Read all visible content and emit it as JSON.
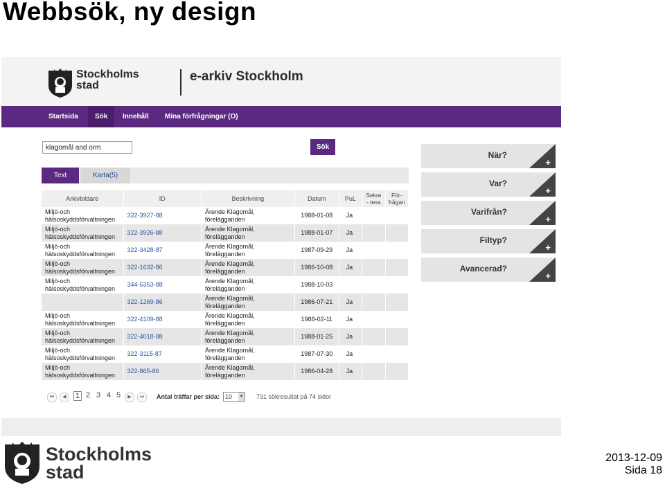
{
  "slide": {
    "title": "Webbsök, ny design",
    "date": "2013-12-09",
    "page": "Sida 18",
    "footer_logo_text": "Stockholms stad"
  },
  "header": {
    "logo_text": "Stockholms stad",
    "site_name": "e-arkiv Stockholm"
  },
  "nav": {
    "items": [
      {
        "label": "Startsida"
      },
      {
        "label": "Sök"
      },
      {
        "label": "Innehåll"
      },
      {
        "label": "Mina förfrågningar (O)"
      }
    ]
  },
  "search": {
    "value": "klagomål and orm",
    "button_label": "Sök"
  },
  "tabs": [
    {
      "label": "Text"
    },
    {
      "label": "Karta(5)"
    }
  ],
  "table": {
    "columns": [
      "Arkivbildare",
      "ID",
      "Beskrivning",
      "Datum",
      "PuL",
      "Sekre - tess",
      "För- frågan"
    ],
    "rows": [
      {
        "arkivbildare": "Miljö-och hälsoskyddsförvaltningen",
        "id": "322-3927-88",
        "beskrivning": "Ärende Klagomål, förelägganden",
        "datum": "1988-01-08",
        "pul": "Ja"
      },
      {
        "arkivbildare": "Miljö-och hälsoskyddsförvaltningen",
        "id": "322-3926-88",
        "beskrivning": "Ärende Klagomål, förelägganden",
        "datum": "1988-01-07",
        "pul": "Ja"
      },
      {
        "arkivbildare": "Miljö-och hälsoskyddsförvaltningen",
        "id": "322-3428-87",
        "beskrivning": "Ärende Klagomål, förelägganden",
        "datum": "1987-09-29",
        "pul": "Ja"
      },
      {
        "arkivbildare": "Miljö-och hälsoskyddsförvaltningen",
        "id": "322-1632-86",
        "beskrivning": "Ärende Klagomål, förelägganden",
        "datum": "1986-10-08",
        "pul": "Ja"
      },
      {
        "arkivbildare": "Miljö-och hälsoskyddsförvaltningen",
        "id": "344-5353-88",
        "beskrivning": "Ärende Klagomål, förelägganden",
        "datum": "1988-10-03",
        "pul": ""
      },
      {
        "arkivbildare": "",
        "id": "322-1269-86",
        "beskrivning": "Ärende Klagomål, förelägganden",
        "datum": "1986-07-21",
        "pul": "Ja"
      },
      {
        "arkivbildare": "Miljö-och hälsoskyddsförvaltningen",
        "id": "322-4109-88",
        "beskrivning": "Ärende Klagomål, förelägganden",
        "datum": "1988-02-11",
        "pul": "Ja"
      },
      {
        "arkivbildare": "Miljö-och hälsoskyddsförvaltningen",
        "id": "322-4018-88",
        "beskrivning": "Ärende Klagomål, förelägganden",
        "datum": "1988-01-25",
        "pul": "Ja"
      },
      {
        "arkivbildare": "Miljö-och hälsoskyddsförvaltningen",
        "id": "322-3115-87",
        "beskrivning": "Ärende Klagomål, förelägganden",
        "datum": "1987-07-30",
        "pul": "Ja"
      },
      {
        "arkivbildare": "Miljö-och hälsoskyddsförvaltningen",
        "id": "322-865-86",
        "beskrivning": "Ärende Klagomål, förelägganden",
        "datum": "1986-04-28",
        "pul": "Ja"
      }
    ]
  },
  "pagination": {
    "pages": [
      "1",
      "2",
      "3",
      "4",
      "5"
    ],
    "current": "1",
    "first_icon": "first-page-icon",
    "prev_icon": "prev-page-icon",
    "next_icon": "next-page-icon",
    "last_icon": "last-page-icon",
    "per_page_label": "Antal träffar per sida:",
    "per_page_value": "10",
    "result_count": "731 sökresultat på 74 sidor"
  },
  "facets": [
    {
      "label": "När?"
    },
    {
      "label": "Var?"
    },
    {
      "label": "Varifrån?"
    },
    {
      "label": "Filtyp?"
    },
    {
      "label": "Avancerad?"
    }
  ],
  "facet_plus": "+",
  "colors": {
    "brand_purple": "#5b2a80",
    "link_blue": "#2a55a0",
    "facet_bg": "#e4e4e2"
  }
}
